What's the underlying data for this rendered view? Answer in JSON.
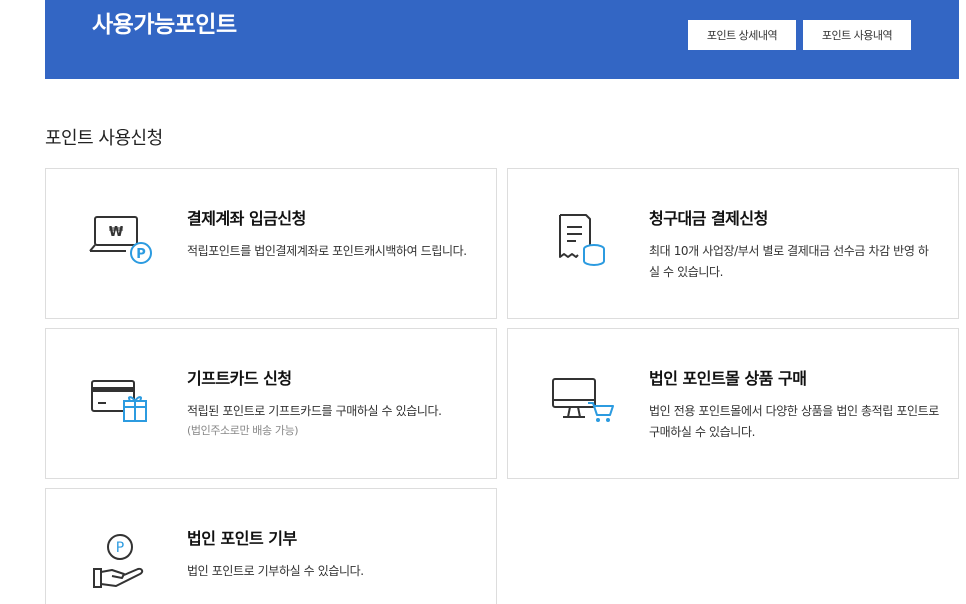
{
  "banner": {
    "title": "사용가능포인트",
    "detail_button": "포인트 상세내역",
    "usage_button": "포인트 사용내역"
  },
  "section": {
    "title": "포인트 사용신청"
  },
  "cards": [
    {
      "title": "결제계좌 입금신청",
      "desc": "적립포인트를 법인결제계좌로 포인트캐시백하여 드립니다.",
      "icon": "laptop-won-point-icon"
    },
    {
      "title": "청구대금 결제신청",
      "desc": "최대 10개 사업장/부서 별로 결제대금 선수금 차감 반영 하실 수 있습니다.",
      "icon": "receipt-coins-icon"
    },
    {
      "title": "기프트카드 신청",
      "desc": "적립된 포인트로 기프트카드를 구매하실 수 있습니다.",
      "note": "(법인주소로만 배송 가능)",
      "icon": "card-gift-icon"
    },
    {
      "title": "법인 포인트몰 상품 구매",
      "desc": "법인 전용 포인트몰에서 다양한 상품을 법인 총적립 포인트로 구매하실 수 있습니다.",
      "icon": "monitor-cart-icon"
    },
    {
      "title": "법인 포인트 기부",
      "desc": "법인 포인트로 기부하실 수 있습니다.",
      "icon": "hand-point-icon"
    }
  ],
  "colors": {
    "banner": "#3366c4",
    "icon_dark": "#333333",
    "icon_accent": "#2c9be0"
  }
}
